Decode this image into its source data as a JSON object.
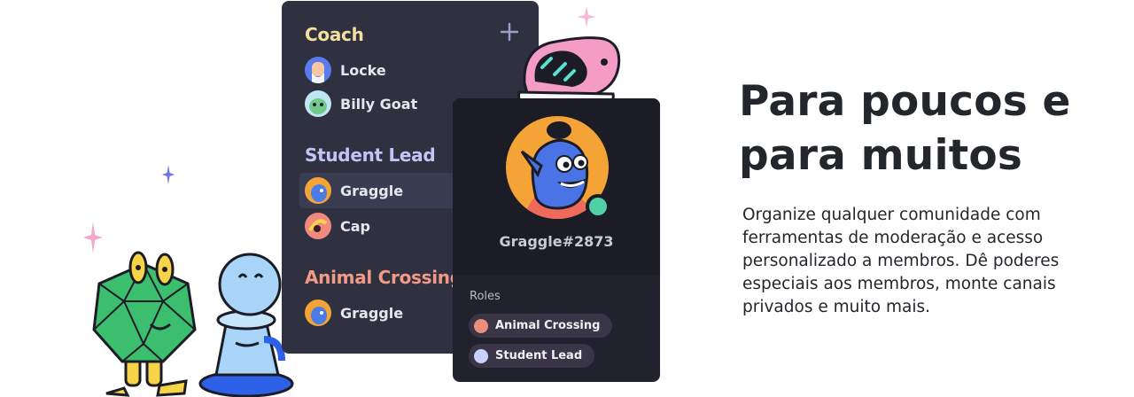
{
  "member_list": {
    "groups": [
      {
        "title": "Coach",
        "color": "#f6df9e",
        "members": [
          "Locke",
          "Billy Goat"
        ]
      },
      {
        "title": "Student Lead",
        "color": "#bfc6f5",
        "members": [
          "Graggle",
          "Cap"
        ]
      },
      {
        "title": "Animal Crossing",
        "color": "#f29a86",
        "members": [
          "Graggle"
        ]
      }
    ],
    "add_icon": "plus-icon"
  },
  "profile": {
    "tag": "Graggle#2873",
    "status": "online",
    "roles_label": "Roles",
    "roles": [
      {
        "name": "Animal Crossing",
        "color": "#ec8f7a"
      },
      {
        "name": "Student Lead",
        "color": "#c9d2ff"
      }
    ]
  },
  "headline": "Para poucos e para muitos",
  "body": "Organize qualquer comunidade com ferramentas de moderação e acesso personalizado a membros. Dê poderes especiais aos membros, monte canais privados e muito mais."
}
